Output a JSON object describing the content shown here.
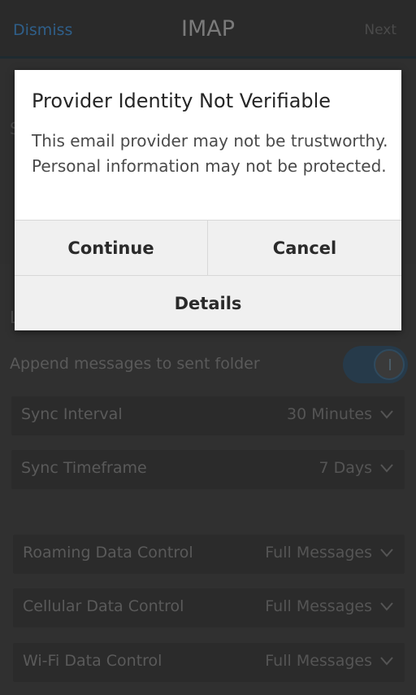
{
  "titlebar": {
    "dismiss_label": "Dismiss",
    "title": "IMAP",
    "next_label": "Next"
  },
  "background": {
    "append_label": "Append messages to sent folder",
    "sync": [
      {
        "label": "Sync Interval",
        "value": "30 Minutes"
      },
      {
        "label": "Sync Timeframe",
        "value": "7 Days"
      }
    ],
    "data_controls": [
      {
        "label": "Roaming Data Control",
        "value": "Full Messages"
      },
      {
        "label": "Cellular Data Control",
        "value": "Full Messages"
      },
      {
        "label": "Wi-Fi Data Control",
        "value": "Full Messages"
      }
    ]
  },
  "dialog": {
    "title": "Provider Identity Not Verifiable",
    "body": "This email provider may not be trustworthy. Personal information may not be protected.",
    "continue_label": "Continue",
    "cancel_label": "Cancel",
    "details_label": "Details"
  }
}
